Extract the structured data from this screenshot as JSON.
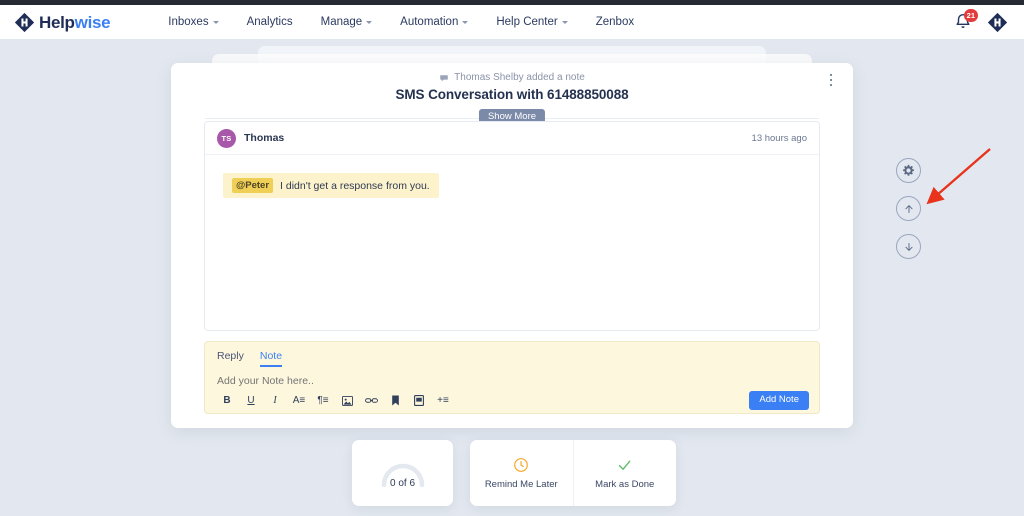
{
  "header": {
    "brand": {
      "name_dark": "Help",
      "name_accent": "wise",
      "logo_icon": "helpwise-logo-icon"
    },
    "nav": [
      {
        "label": "Inboxes",
        "has_dropdown": true
      },
      {
        "label": "Analytics",
        "has_dropdown": false
      },
      {
        "label": "Manage",
        "has_dropdown": true
      },
      {
        "label": "Automation",
        "has_dropdown": true
      },
      {
        "label": "Help Center",
        "has_dropdown": true
      },
      {
        "label": "Zenbox",
        "has_dropdown": false
      }
    ],
    "notification": {
      "icon": "bell-icon",
      "badge_count": "21"
    },
    "account": {
      "icon": "helpwise-avatar-icon"
    }
  },
  "conversation": {
    "activity_icon": "comment-icon",
    "activity_text": "Thomas Shelby added a note",
    "title": "SMS Conversation with 61488850088",
    "menu_icon": "kebab-menu-icon",
    "show_more_label": "Show More",
    "message": {
      "avatar_initials": "TS",
      "avatar_color": "#a858a8",
      "author": "Thomas",
      "timestamp": "13 hours ago",
      "mention": "@Peter",
      "body": "I didn't get a response from you."
    }
  },
  "composer": {
    "tabs": [
      {
        "label": "Reply",
        "active": false
      },
      {
        "label": "Note",
        "active": true
      }
    ],
    "placeholder": "Add your Note here..",
    "value": "",
    "toolbar": [
      {
        "name": "bold-icon",
        "glyph": "B"
      },
      {
        "name": "underline-icon",
        "glyph": "U"
      },
      {
        "name": "italic-icon",
        "glyph": "I"
      },
      {
        "name": "font-size-icon",
        "glyph": "A≡"
      },
      {
        "name": "paragraph-icon",
        "glyph": "¶≡"
      },
      {
        "name": "insert-image-icon",
        "glyph": "⛰"
      },
      {
        "name": "insert-link-icon",
        "glyph": "⚭"
      },
      {
        "name": "bookmark-icon",
        "glyph": "⚑"
      },
      {
        "name": "saved-reply-icon",
        "glyph": "☰"
      },
      {
        "name": "add-more-icon",
        "glyph": "+≡"
      }
    ],
    "submit_label": "Add Note"
  },
  "bottom": {
    "progress": {
      "label": "0 of 6",
      "value": 0,
      "total": 6
    },
    "actions": [
      {
        "label": "Remind Me Later",
        "icon": "clock-icon",
        "color": "#f5a623"
      },
      {
        "label": "Mark as Done",
        "icon": "check-icon",
        "color": "#5fbd6a"
      }
    ]
  },
  "rail": [
    {
      "name": "settings-gear-button",
      "icon": "gear-icon",
      "highlighted": true
    },
    {
      "name": "previous-conversation-button",
      "icon": "arrow-up-icon",
      "highlighted": false
    },
    {
      "name": "next-conversation-button",
      "icon": "arrow-down-icon",
      "highlighted": false
    }
  ],
  "annotation": {
    "type": "pointer-arrow",
    "color": "#e8341c",
    "target": "settings-gear-button"
  },
  "colors": {
    "page_background": "#e3e8f0",
    "accent_blue": "#3b7ff5",
    "note_background": "#fdf7dd",
    "mention_chip": "#f0cf57",
    "brand_navy": "#1f2d56"
  }
}
